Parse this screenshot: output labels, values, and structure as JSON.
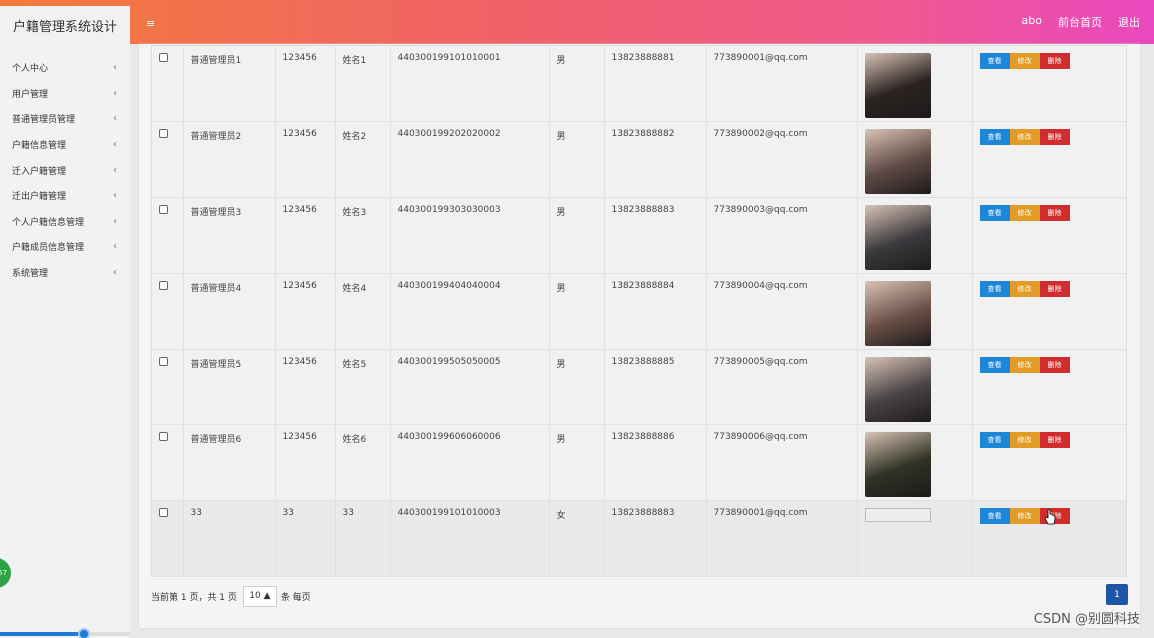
{
  "app": {
    "title": "户籍管理系统设计"
  },
  "header": {
    "menu_icon": "hamburger-icon",
    "links": [
      "abo",
      "前台首页",
      "退出"
    ]
  },
  "sidebar": {
    "items": [
      {
        "label": "个人中心"
      },
      {
        "label": "用户管理"
      },
      {
        "label": "普通管理员管理"
      },
      {
        "label": "户籍信息管理"
      },
      {
        "label": "迁入户籍管理"
      },
      {
        "label": "迁出户籍管理"
      },
      {
        "label": "个人户籍信息管理"
      },
      {
        "label": "户籍成员信息管理"
      },
      {
        "label": "系统管理"
      }
    ]
  },
  "table": {
    "rows": [
      {
        "account": "普通管理员1",
        "password": "123456",
        "name": "姓名1",
        "id_no": "440300199101010001",
        "gender": "男",
        "phone": "13823888881",
        "email": "773890001@qq.com",
        "photo": "portrait-1",
        "photo_color": "#2b2322"
      },
      {
        "account": "普通管理员2",
        "password": "123456",
        "name": "姓名2",
        "id_no": "440300199202020002",
        "gender": "男",
        "phone": "13823888882",
        "email": "773890002@qq.com",
        "photo": "portrait-2",
        "photo_color": "#5e4a45"
      },
      {
        "account": "普通管理员3",
        "password": "123456",
        "name": "姓名3",
        "id_no": "440300199303030003",
        "gender": "男",
        "phone": "13823888883",
        "email": "773890003@qq.com",
        "photo": "portrait-3",
        "photo_color": "#3c3a3e"
      },
      {
        "account": "普通管理员4",
        "password": "123456",
        "name": "姓名4",
        "id_no": "440300199404040004",
        "gender": "男",
        "phone": "13823888884",
        "email": "773890004@qq.com",
        "photo": "portrait-4",
        "photo_color": "#6b5048"
      },
      {
        "account": "普通管理员5",
        "password": "123456",
        "name": "姓名5",
        "id_no": "440300199505050005",
        "gender": "男",
        "phone": "13823888885",
        "email": "773890005@qq.com",
        "photo": "portrait-5",
        "photo_color": "#4a4346"
      },
      {
        "account": "普通管理员6",
        "password": "123456",
        "name": "姓名6",
        "id_no": "440300199606060006",
        "gender": "男",
        "phone": "13823888886",
        "email": "773890006@qq.com",
        "photo": "portrait-6",
        "photo_color": "#2f3325"
      },
      {
        "account": "33",
        "password": "33",
        "name": "33",
        "id_no": "440300199101010003",
        "gender": "女",
        "phone": "13823888883",
        "email": "773890001@qq.com",
        "photo": "broken-image",
        "photo_color": "#eeeeee"
      }
    ],
    "actions": {
      "view": "查看",
      "edit": "修改",
      "delete": "删除"
    }
  },
  "pager": {
    "info": "当前第 1 页，共 1 页",
    "page_size": "10",
    "per_page_label": "条 每页",
    "current_page": "1"
  },
  "watermark": "CSDN @别圆科技",
  "colors": {
    "header_gradient_start": "#f47b3b",
    "header_gradient_end": "#ea48bf",
    "view_button": "#1b87d6",
    "edit_button": "#e29b27",
    "delete_button": "#d02e2e",
    "page_active": "#1e55a6"
  }
}
